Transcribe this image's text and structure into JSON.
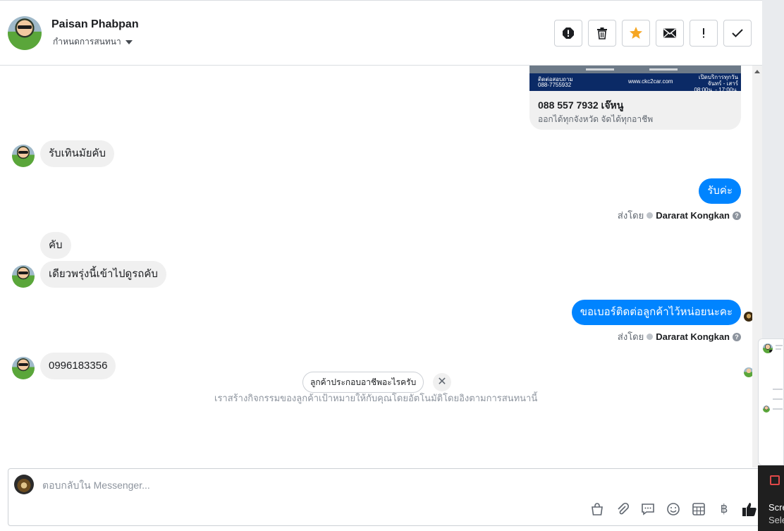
{
  "header": {
    "contact_name": "Paisan Phabpan",
    "assign_label": "กำหนดการสนทนา",
    "tools": [
      {
        "name": "spam-icon",
        "glyph": "!"
      },
      {
        "name": "trash-icon"
      },
      {
        "name": "star-icon",
        "color": "#f5a623"
      },
      {
        "name": "mail-icon"
      },
      {
        "name": "exclamation-icon",
        "glyph": "!"
      },
      {
        "name": "checkmark-icon"
      }
    ]
  },
  "card": {
    "image_contact": "ติดต่อสอบถาม\n088-7755932",
    "image_site": "www.ckc2car.com",
    "image_hours": "เปิดบริการทุกวัน\nจันทร์ - เสาร์\n08:00น. - 17:00น.",
    "title": "088 557 7932 เจ๊หนู",
    "subtitle": "ออกได้ทุกจังหวัด จัดได้ทุกอาชีพ"
  },
  "messages": {
    "in_1": "รับเทินมัยคับ",
    "out_1": "รับค่ะ",
    "in_2": "คับ",
    "in_3": "เดียวพรุ่งนี้เข้าไปดูรถคับ",
    "out_2": "ขอเบอร์ติดต่อลูกค้าไว้หน่อยนะคะ",
    "in_4": "0996183356"
  },
  "sent_by": {
    "prefix": "ส่งโดย",
    "agent": "Dararat Kongkan",
    "help": "?"
  },
  "suggestion": {
    "chip": "ลูกค้าประกอบอาชีพอะไรครับ",
    "close": "✕",
    "note": "เราสร้างกิจกรรมของลูกค้าเป้าหมายให้กับคุณโดยอัตโนมัติโดยอิงตามการสนทนานี้"
  },
  "composer": {
    "placeholder": "ตอบกลับใน Messenger...",
    "currency_glyph": "฿"
  },
  "overlay": {
    "text_1": "Scre",
    "text_2": "Sele"
  },
  "colors": {
    "accent": "#0084ff",
    "incoming_bubble": "#f0f0f0",
    "star": "#f5a623"
  }
}
